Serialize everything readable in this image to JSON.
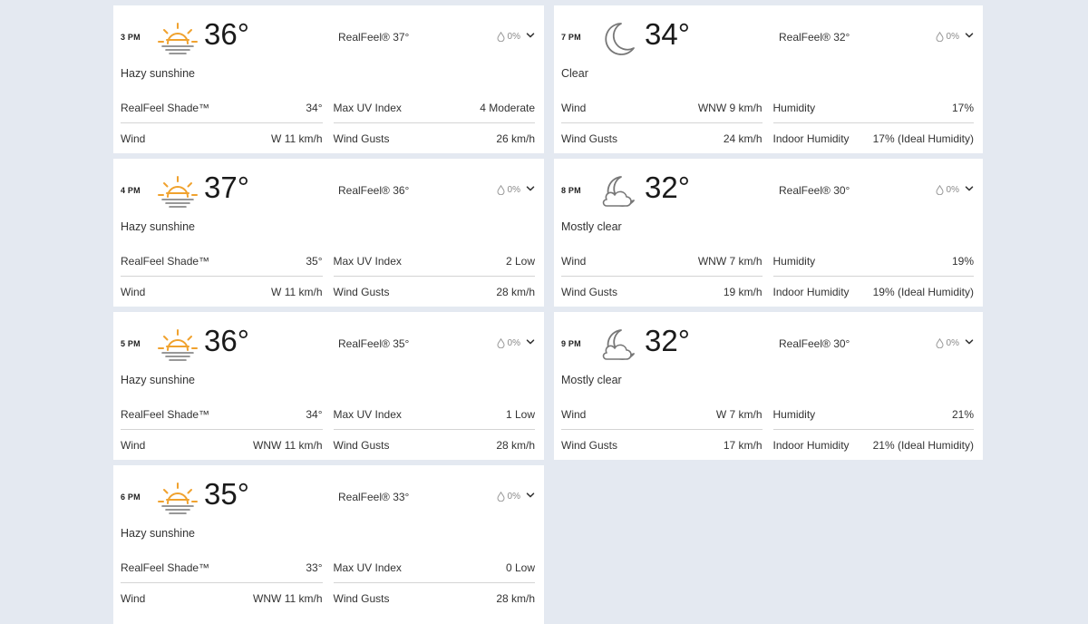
{
  "colors": {
    "background": "#e4e9f1",
    "card": "#ffffff",
    "sun_icon": "#f0a22e",
    "moon_icon": "#888888",
    "precip_text": "#8a8a8a"
  },
  "cards": [
    {
      "time": "3 PM",
      "icon": "hazy-sun-icon",
      "temp": "36°",
      "realfeel": "RealFeel® 37°",
      "precip": "0%",
      "phrase": "Hazy sunshine",
      "details": [
        {
          "label": "RealFeel Shade™",
          "value": "34°"
        },
        {
          "label": "Max UV Index",
          "value": "4 Moderate"
        },
        {
          "label": "Wind",
          "value": "W 11 km/h"
        },
        {
          "label": "Wind Gusts",
          "value": "26 km/h"
        }
      ]
    },
    {
      "time": "4 PM",
      "icon": "hazy-sun-icon",
      "temp": "37°",
      "realfeel": "RealFeel® 36°",
      "precip": "0%",
      "phrase": "Hazy sunshine",
      "details": [
        {
          "label": "RealFeel Shade™",
          "value": "35°"
        },
        {
          "label": "Max UV Index",
          "value": "2 Low"
        },
        {
          "label": "Wind",
          "value": "W 11 km/h"
        },
        {
          "label": "Wind Gusts",
          "value": "28 km/h"
        }
      ]
    },
    {
      "time": "5 PM",
      "icon": "hazy-sun-icon",
      "temp": "36°",
      "realfeel": "RealFeel® 35°",
      "precip": "0%",
      "phrase": "Hazy sunshine",
      "details": [
        {
          "label": "RealFeel Shade™",
          "value": "34°"
        },
        {
          "label": "Max UV Index",
          "value": "1 Low"
        },
        {
          "label": "Wind",
          "value": "WNW 11 km/h"
        },
        {
          "label": "Wind Gusts",
          "value": "28 km/h"
        }
      ]
    },
    {
      "time": "6 PM",
      "icon": "hazy-sun-icon",
      "temp": "35°",
      "realfeel": "RealFeel® 33°",
      "precip": "0%",
      "phrase": "Hazy sunshine",
      "details": [
        {
          "label": "RealFeel Shade™",
          "value": "33°"
        },
        {
          "label": "Max UV Index",
          "value": "0 Low"
        },
        {
          "label": "Wind",
          "value": "WNW 11 km/h"
        },
        {
          "label": "Wind Gusts",
          "value": "28 km/h"
        }
      ]
    },
    {
      "time": "7 PM",
      "icon": "moon-icon",
      "temp": "34°",
      "realfeel": "RealFeel® 32°",
      "precip": "0%",
      "phrase": "Clear",
      "details": [
        {
          "label": "Wind",
          "value": "WNW 9 km/h"
        },
        {
          "label": "Humidity",
          "value": "17%"
        },
        {
          "label": "Wind Gusts",
          "value": "24 km/h"
        },
        {
          "label": "Indoor Humidity",
          "value": "17% (Ideal Humidity)"
        }
      ]
    },
    {
      "time": "8 PM",
      "icon": "moon-cloud-icon",
      "temp": "32°",
      "realfeel": "RealFeel® 30°",
      "precip": "0%",
      "phrase": "Mostly clear",
      "details": [
        {
          "label": "Wind",
          "value": "WNW 7 km/h"
        },
        {
          "label": "Humidity",
          "value": "19%"
        },
        {
          "label": "Wind Gusts",
          "value": "19 km/h"
        },
        {
          "label": "Indoor Humidity",
          "value": "19% (Ideal Humidity)"
        }
      ]
    },
    {
      "time": "9 PM",
      "icon": "moon-cloud-icon",
      "temp": "32°",
      "realfeel": "RealFeel® 30°",
      "precip": "0%",
      "phrase": "Mostly clear",
      "details": [
        {
          "label": "Wind",
          "value": "W 7 km/h"
        },
        {
          "label": "Humidity",
          "value": "21%"
        },
        {
          "label": "Wind Gusts",
          "value": "17 km/h"
        },
        {
          "label": "Indoor Humidity",
          "value": "21% (Ideal Humidity)"
        }
      ]
    }
  ]
}
